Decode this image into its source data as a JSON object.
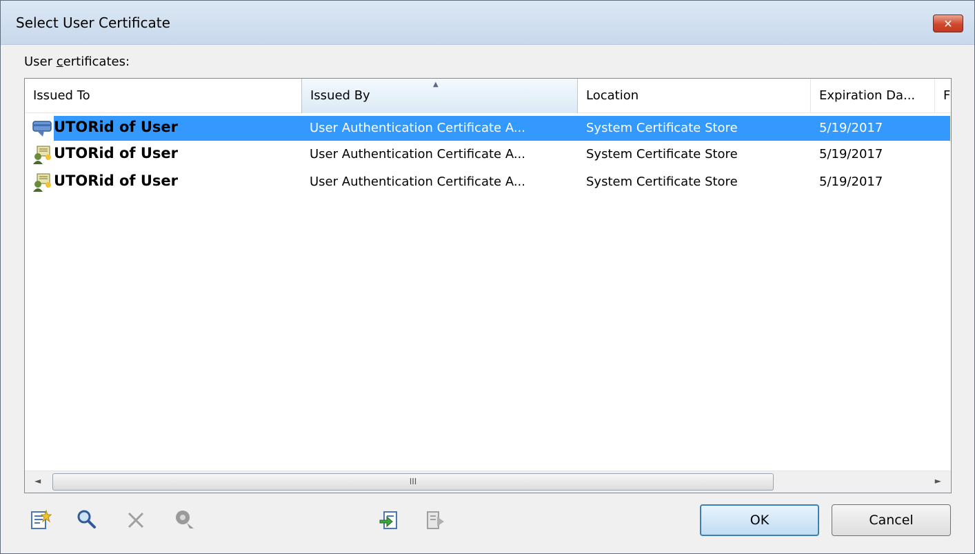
{
  "window": {
    "title": "Select User Certificate",
    "close_label": "✕"
  },
  "section_label_prefix": "User ",
  "section_label_accel": "c",
  "section_label_suffix": "ertificates:",
  "columns": [
    {
      "label": "Issued To"
    },
    {
      "label": "Issued By",
      "sorted": true
    },
    {
      "label": "Location"
    },
    {
      "label": "Expiration Da..."
    },
    {
      "label": "F"
    }
  ],
  "rows": [
    {
      "issued_to": "UTORid of User",
      "issued_by": "User Authentication Certificate A...",
      "location": "System Certificate Store",
      "expiration": "5/19/2017",
      "selected": true,
      "icon": "smartcard-certificate-icon"
    },
    {
      "issued_to": "UTORid of User",
      "issued_by": "User Authentication Certificate A...",
      "location": "System Certificate Store",
      "expiration": "5/19/2017",
      "selected": false,
      "icon": "user-certificate-icon"
    },
    {
      "issued_to": "UTORid of User",
      "issued_by": "User Authentication Certificate A...",
      "location": "System Certificate Store",
      "expiration": "5/19/2017",
      "selected": false,
      "icon": "user-certificate-icon"
    }
  ],
  "scrollbar": {
    "left_arrow": "◄",
    "right_arrow": "►",
    "grip": "III"
  },
  "toolbar_icons": [
    "new-certificate-icon",
    "view-certificate-icon",
    "delete-icon",
    "properties-icon",
    "import-icon",
    "export-icon"
  ],
  "buttons": {
    "ok": "OK",
    "cancel": "Cancel"
  },
  "colors": {
    "selection": "#3399ff",
    "title_bar": "#dbe7f4",
    "close_button": "#d1472c"
  }
}
